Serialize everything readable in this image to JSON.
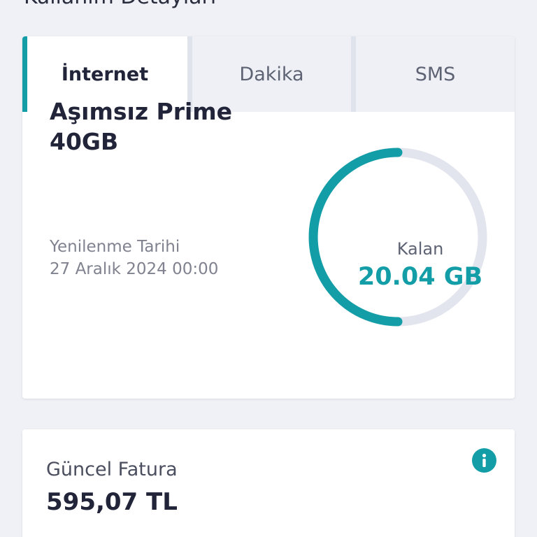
{
  "header": {
    "title": "Kullanım Detayları"
  },
  "usage": {
    "tabs": [
      {
        "label": "İnternet",
        "active": true
      },
      {
        "label": "Dakika",
        "active": false
      },
      {
        "label": "SMS",
        "active": false
      }
    ],
    "plan_name": "Aşımsız Prime 40GB",
    "renewal_label": "Yenilenme Tarihi",
    "renewal_date": "27 Aralık 2024 00:00",
    "remaining_label": "Kalan",
    "remaining_value": "20.04 GB",
    "remaining_fraction": 0.5
  },
  "bill": {
    "label": "Güncel Fatura",
    "amount": "595,07 TL",
    "info_icon": "info-icon"
  },
  "colors": {
    "accent": "#139ea7",
    "track": "#e2e5ee",
    "text_dark": "#22253a",
    "text_muted": "#80838f",
    "background": "#eff1f6"
  }
}
